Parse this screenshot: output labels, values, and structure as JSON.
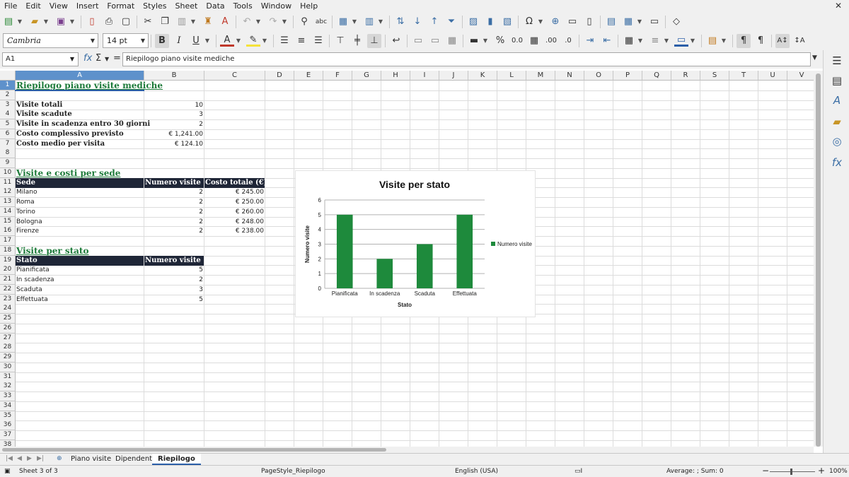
{
  "menu": [
    "File",
    "Edit",
    "View",
    "Insert",
    "Format",
    "Styles",
    "Sheet",
    "Data",
    "Tools",
    "Window",
    "Help"
  ],
  "toolbar": {
    "font_name": "Cambria",
    "font_size": "14 pt",
    "bold": "B",
    "italic": "I",
    "underline": "U",
    "percent": "%",
    "number_format": "0.0",
    "add_decimal": ".00",
    "del_decimal": ".0"
  },
  "formula_bar": {
    "cell_ref": "A1",
    "sum_icon": "Σ",
    "equals_icon": "=",
    "content": "Riepilogo piano visite mediche"
  },
  "columns": [
    "A",
    "B",
    "C",
    "D",
    "E",
    "F",
    "G",
    "H",
    "I",
    "J",
    "K",
    "L",
    "M",
    "N",
    "O",
    "P",
    "Q",
    "R",
    "S",
    "T",
    "U",
    "V"
  ],
  "sheet": {
    "title": "Riepilogo piano visite mediche",
    "summary": [
      {
        "label": "Visite totali",
        "value": "10"
      },
      {
        "label": "Visite scadute",
        "value": "3"
      },
      {
        "label": "Visite in scadenza entro 30 giorni",
        "value": "2"
      },
      {
        "label": "Costo complessivo previsto",
        "value": "€ 1,241.00"
      },
      {
        "label": "Costo medio per visita",
        "value": "€ 124.10"
      }
    ],
    "section_sede": {
      "title": "Visite e costi per sede",
      "headers": [
        "Sede",
        "Numero visite",
        "Costo totale (€)"
      ],
      "rows": [
        [
          "Milano",
          "2",
          "€ 245.00"
        ],
        [
          "Roma",
          "2",
          "€ 250.00"
        ],
        [
          "Torino",
          "2",
          "€ 260.00"
        ],
        [
          "Bologna",
          "2",
          "€ 248.00"
        ],
        [
          "Firenze",
          "2",
          "€ 238.00"
        ]
      ]
    },
    "section_stato": {
      "title": "Visite per stato",
      "headers": [
        "Stato",
        "Numero visite"
      ],
      "rows": [
        [
          "Pianificata",
          "5"
        ],
        [
          "In scadenza",
          "2"
        ],
        [
          "Scaduta",
          "3"
        ],
        [
          "Effettuata",
          "5"
        ]
      ]
    }
  },
  "chart_data": {
    "type": "bar",
    "title": "Visite per stato",
    "categories": [
      "Pianificata",
      "In scadenza",
      "Scaduta",
      "Effettuata"
    ],
    "series": [
      {
        "name": "Numero visite",
        "values": [
          5,
          2,
          3,
          5
        ],
        "color": "#1e8a3c"
      }
    ],
    "xlabel": "Stato",
    "ylabel": "Numero visite",
    "ylim": [
      0,
      6
    ],
    "yticks": [
      0,
      1,
      2,
      3,
      4,
      5,
      6
    ],
    "legend": "right",
    "grid": true
  },
  "tabs": {
    "sheets": [
      "Piano visite",
      "Dipendenti",
      "Riepilogo"
    ],
    "active": "Riepilogo"
  },
  "status": {
    "sheet": "Sheet 3 of 3",
    "page_style": "PageStyle_Riepilogo",
    "language": "English (USA)",
    "summary": "Average: ; Sum: 0",
    "zoom": "100%"
  },
  "colors": {
    "accent": "#2b5fa8",
    "title_green": "#1e7b3a",
    "header_dark": "#1f2637",
    "bar_green": "#1e8a3c"
  }
}
